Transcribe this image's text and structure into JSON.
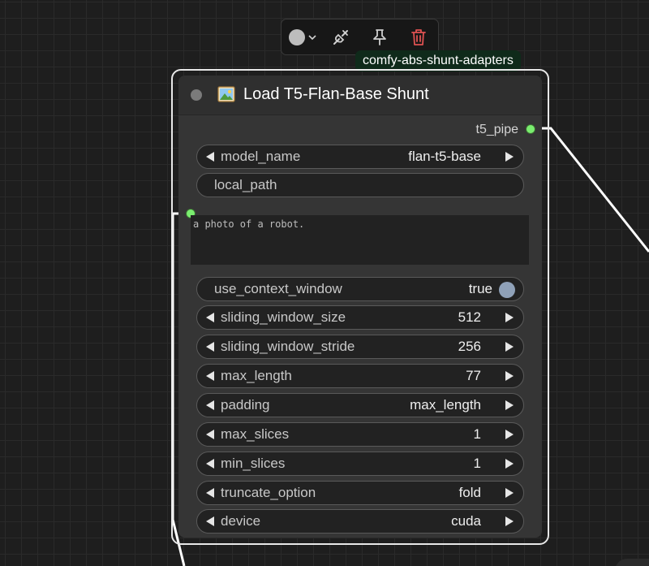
{
  "toolbar": {
    "color_swatch": "#bdbdbd",
    "delete_color": "#e05252",
    "icons": [
      "color-picker-icon",
      "chevron-down-icon",
      "bypass-icon",
      "pin-icon",
      "trash-icon"
    ]
  },
  "source_badge": "comfy-abs-shunt-adapters",
  "node": {
    "title": "Load T5-Flan-Base Shunt",
    "icon": "image-icon",
    "output_label": "t5_pipe",
    "slot_color": "#7aed6f",
    "prompt_text": "a photo of a robot.",
    "widgets": [
      {
        "label": "model_name",
        "value": "flan-t5-base",
        "kind": "combo"
      },
      {
        "label": "local_path",
        "value": "",
        "kind": "text"
      },
      {
        "label": "use_context_window",
        "value": "true",
        "kind": "toggle"
      },
      {
        "label": "sliding_window_size",
        "value": "512",
        "kind": "number"
      },
      {
        "label": "sliding_window_stride",
        "value": "256",
        "kind": "number"
      },
      {
        "label": "max_length",
        "value": "77",
        "kind": "number"
      },
      {
        "label": "padding",
        "value": "max_length",
        "kind": "combo"
      },
      {
        "label": "max_slices",
        "value": "1",
        "kind": "number"
      },
      {
        "label": "min_slices",
        "value": "1",
        "kind": "number"
      },
      {
        "label": "truncate_option",
        "value": "fold",
        "kind": "combo"
      },
      {
        "label": "device",
        "value": "cuda",
        "kind": "combo"
      }
    ]
  }
}
